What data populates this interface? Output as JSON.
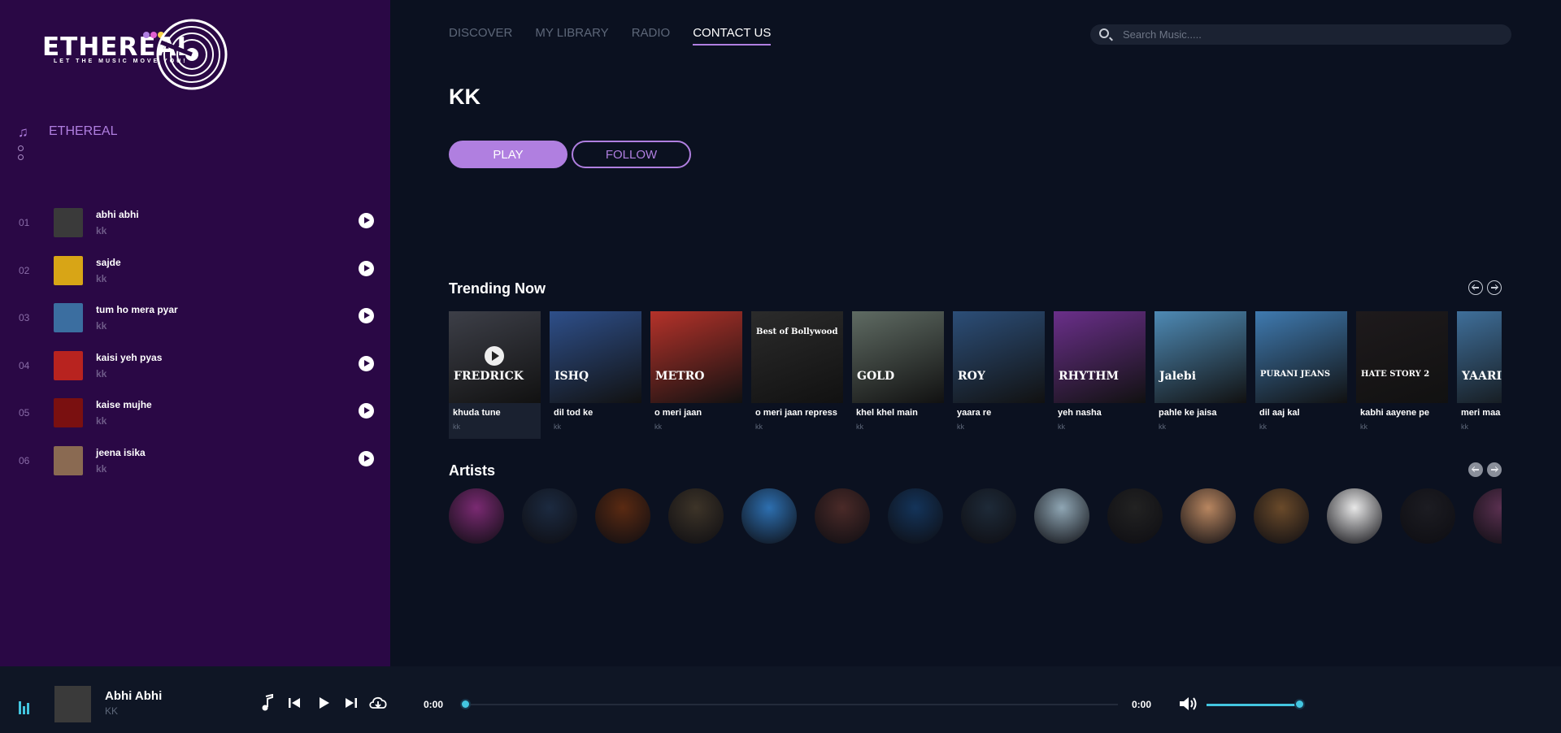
{
  "brand": {
    "logo_text": "ETHEREAL",
    "tagline": "LET THE MUSIC MOVE YOU!",
    "dot_colors": [
      "#b07fe0",
      "#e05fd0",
      "#f7d34a"
    ]
  },
  "sidebar": {
    "section_label": "ETHEREAL",
    "songs": [
      {
        "num": "01",
        "title": "abhi abhi",
        "artist": "kk",
        "thumb_color": "#3a3a3a"
      },
      {
        "num": "02",
        "title": "sajde",
        "artist": "kk",
        "thumb_color": "#d8a516"
      },
      {
        "num": "03",
        "title": "tum ho mera pyar",
        "artist": "kk",
        "thumb_color": "#3b6ea0"
      },
      {
        "num": "04",
        "title": "kaisi yeh pyas",
        "artist": "kk",
        "thumb_color": "#b8231f"
      },
      {
        "num": "05",
        "title": "kaise mujhe",
        "artist": "kk",
        "thumb_color": "#7a1010"
      },
      {
        "num": "06",
        "title": "jeena isika",
        "artist": "kk",
        "thumb_color": "#8a6a52"
      }
    ]
  },
  "nav": {
    "items": [
      "DISCOVER",
      "MY LIBRARY",
      "RADIO",
      "CONTACT US"
    ],
    "active": "CONTACT US"
  },
  "search": {
    "placeholder": "Search Music....."
  },
  "artist_page": {
    "title": "KK",
    "play_label": "PLAY",
    "follow_label": "FOLLOW"
  },
  "trending": {
    "title": "Trending Now",
    "items": [
      {
        "title": "khuda tune",
        "artist": "kk",
        "color": "#3d3f48",
        "label": "FREDRICK"
      },
      {
        "title": "dil tod ke",
        "artist": "kk",
        "color": "#2e4f8a",
        "label": "ISHQ"
      },
      {
        "title": "o meri jaan",
        "artist": "kk",
        "color": "#b5322a",
        "label": "METRO"
      },
      {
        "title": "o meri jaan repress",
        "artist": "kk",
        "color": "#2b2b2b",
        "label": "Best of Bollywood"
      },
      {
        "title": "khel khel main",
        "artist": "kk",
        "color": "#5f6b63",
        "label": "GOLD"
      },
      {
        "title": "yaara re",
        "artist": "kk",
        "color": "#2c4e78",
        "label": "ROY"
      },
      {
        "title": "yeh nasha",
        "artist": "kk",
        "color": "#6a2f8a",
        "label": "RHYTHM"
      },
      {
        "title": "pahle ke jaisa",
        "artist": "kk",
        "color": "#4e8ab5",
        "label": "Jalebi"
      },
      {
        "title": "dil aaj kal",
        "artist": "kk",
        "color": "#3f7ab0",
        "label": "PURANI JEANS"
      },
      {
        "title": "kabhi aayene pe",
        "artist": "kk",
        "color": "#1e1a1c",
        "label": "HATE STORY 2"
      },
      {
        "title": "meri maa",
        "artist": "kk",
        "color": "#3f6f9a",
        "label": "YAARIYAN"
      }
    ]
  },
  "artists": {
    "title": "Artists",
    "colors": [
      "#7a2a72",
      "#1c2a40",
      "#5a2a12",
      "#3d3428",
      "#2d6fb0",
      "#4a2a28",
      "#14345a",
      "#1e2a38",
      "#8fa6b4",
      "#222222",
      "#b88660",
      "#6a4a2a",
      "#e8e8e8",
      "#1c1c22",
      "#5a3050"
    ]
  },
  "player": {
    "title": "Abhi Abhi",
    "artist": "KK",
    "current_time": "0:00",
    "duration": "0:00",
    "progress": 0,
    "volume": 1
  }
}
